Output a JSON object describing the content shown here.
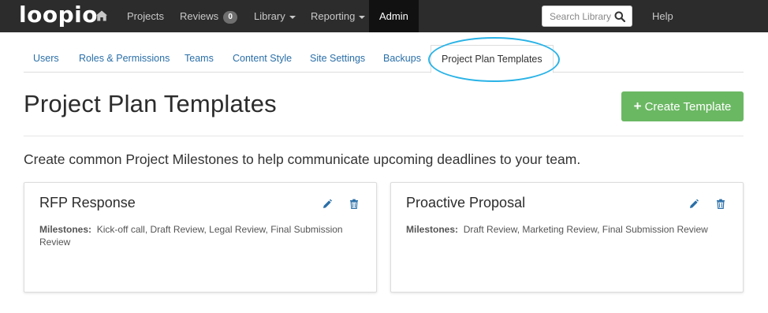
{
  "app": {
    "logo_text": "loopio"
  },
  "topnav": {
    "home_icon": "home-icon",
    "items": [
      {
        "label": "Projects"
      },
      {
        "label": "Reviews",
        "badge": "0"
      },
      {
        "label": "Library"
      },
      {
        "label": "Reporting"
      },
      {
        "label": "Admin"
      }
    ],
    "search": {
      "placeholder": "Search Library"
    },
    "help": "Help"
  },
  "tabs": [
    {
      "label": "Users"
    },
    {
      "label": "Roles & Permissions"
    },
    {
      "label": "Teams"
    },
    {
      "label": "Content Style"
    },
    {
      "label": "Site Settings"
    },
    {
      "label": "Backups"
    },
    {
      "label": "Project Plan Templates"
    }
  ],
  "page": {
    "title": "Project Plan Templates",
    "create_button": "Create Template",
    "description": "Create common Project Milestones to help communicate upcoming deadlines to your team."
  },
  "templates": [
    {
      "title": "RFP Response",
      "milestones_label": "Milestones:",
      "milestones": "Kick-off call,  Draft Review,  Legal Review,  Final Submission Review"
    },
    {
      "title": "Proactive Proposal",
      "milestones_label": "Milestones:",
      "milestones": "Draft Review,  Marketing Review,  Final Submission Review"
    }
  ],
  "colors": {
    "topnav_bg": "#2c2c2c",
    "link": "#2a6fa8",
    "create_button": "#6bb863",
    "annotation_ellipse": "#2ab3e6"
  }
}
